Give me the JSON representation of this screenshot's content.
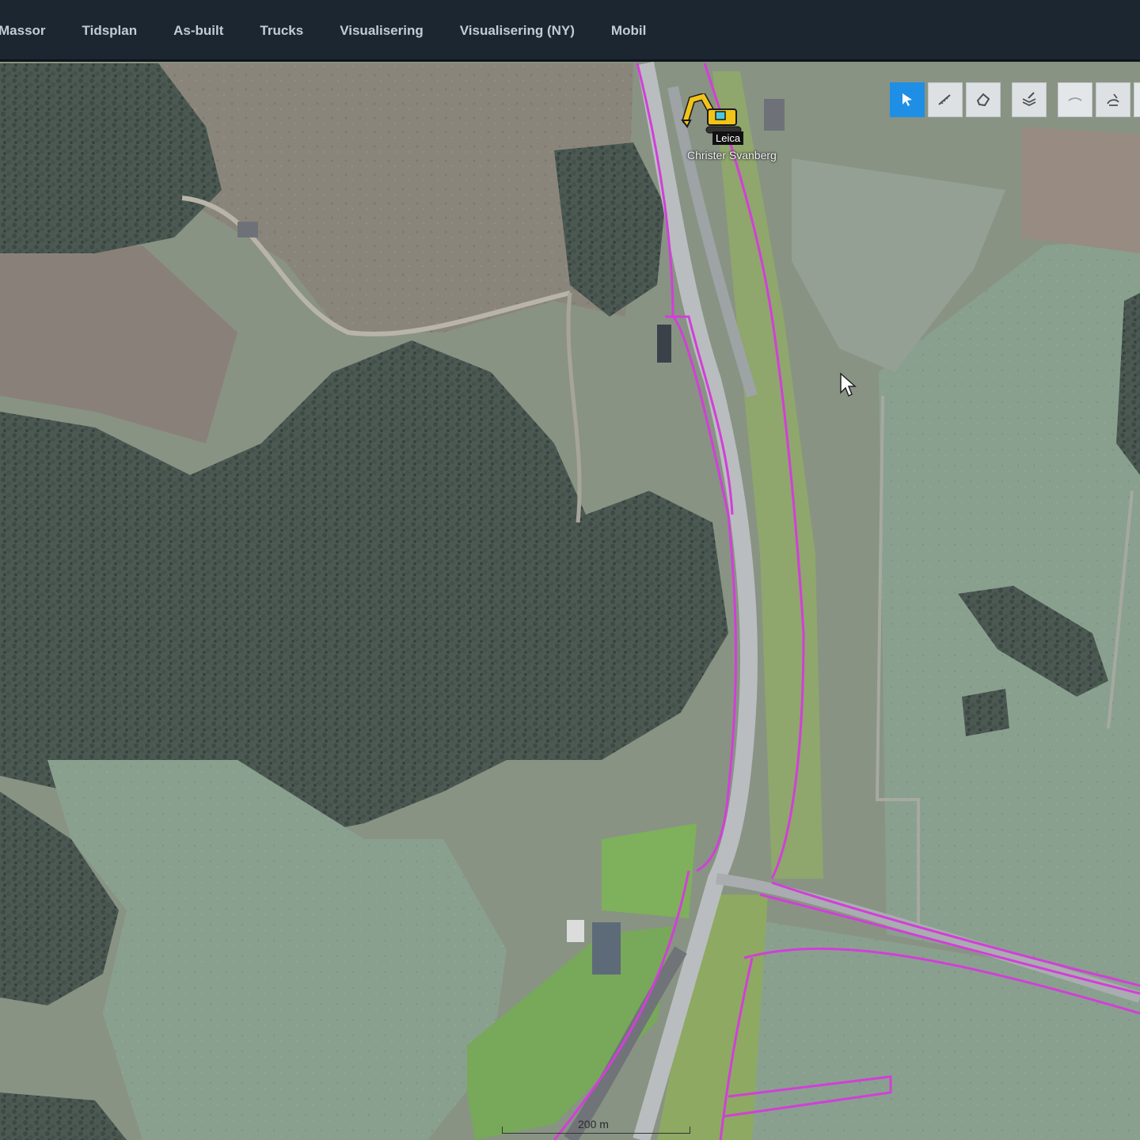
{
  "nav": {
    "items": [
      {
        "label": "Massor",
        "icon": "nav-link"
      },
      {
        "label": "Tidsplan",
        "icon": "nav-link"
      },
      {
        "label": "As-built",
        "icon": "nav-link"
      },
      {
        "label": "Trucks",
        "icon": "nav-link"
      },
      {
        "label": "Visualisering",
        "icon": "nav-link"
      },
      {
        "label": "Visualisering (NY)",
        "icon": "nav-link"
      },
      {
        "label": "Mobil",
        "icon": "nav-link"
      }
    ]
  },
  "toolbar": {
    "tools": [
      {
        "icon": "pointer-select-icon",
        "active": true
      },
      {
        "icon": "measure-line-icon",
        "active": false
      },
      {
        "icon": "measure-area-icon",
        "active": false
      },
      {
        "icon": "edit-layers-icon",
        "active": false
      },
      {
        "icon": "surface-icon",
        "active": false
      },
      {
        "icon": "sketch-icon",
        "active": false
      }
    ]
  },
  "map": {
    "vehicle": {
      "icon": "excavator-icon",
      "tag": "Leica",
      "operator": "Christer Svanberg"
    },
    "scale_label": "200 m",
    "boundary_color": "#d23fd8"
  },
  "colors": {
    "topbar": "#1c2630",
    "nav_text": "#c3cbd3",
    "active_tool": "#1f8fe6"
  }
}
